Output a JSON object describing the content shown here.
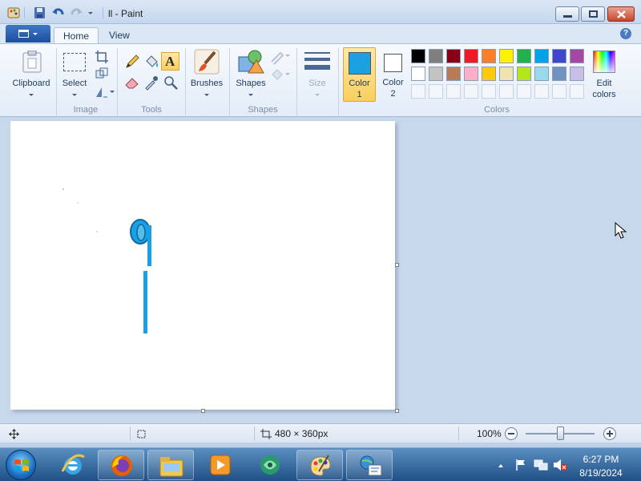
{
  "window": {
    "title": "ll - Paint"
  },
  "tabs": [
    "Home",
    "View"
  ],
  "ribbon": {
    "clipboard": {
      "label": "Clipboard"
    },
    "image": {
      "select_label": "Select",
      "group": "Image"
    },
    "tools": {
      "group": "Tools"
    },
    "brushes": {
      "label": "Brushes"
    },
    "shapes": {
      "label": "Shapes",
      "group": "Shapes"
    },
    "size": {
      "label": "Size"
    },
    "color1": {
      "label": "Color",
      "num": "1",
      "color": "#1ba1e2"
    },
    "color2": {
      "label": "Color",
      "num": "2",
      "color": "#ffffff"
    },
    "colors_group": "Colors",
    "edit_colors": {
      "line1": "Edit",
      "line2": "colors"
    },
    "palette_row1": [
      "#000000",
      "#7f7f7f",
      "#880015",
      "#ed1c24",
      "#ff7f27",
      "#fff200",
      "#22b14c",
      "#00a2e8",
      "#3f48cc",
      "#a349a4"
    ],
    "palette_row2": [
      "#ffffff",
      "#c3c3c3",
      "#b97a57",
      "#ffaec9",
      "#ffc90e",
      "#efe4b0",
      "#b5e61d",
      "#99d9ea",
      "#7092be",
      "#c8bfe7"
    ]
  },
  "status": {
    "canvas_size": "480 × 360px",
    "zoom": "100%",
    "zoom_fraction": 0.5
  },
  "taskbar": {
    "time": "6:27 PM",
    "date": "8/19/2024"
  }
}
